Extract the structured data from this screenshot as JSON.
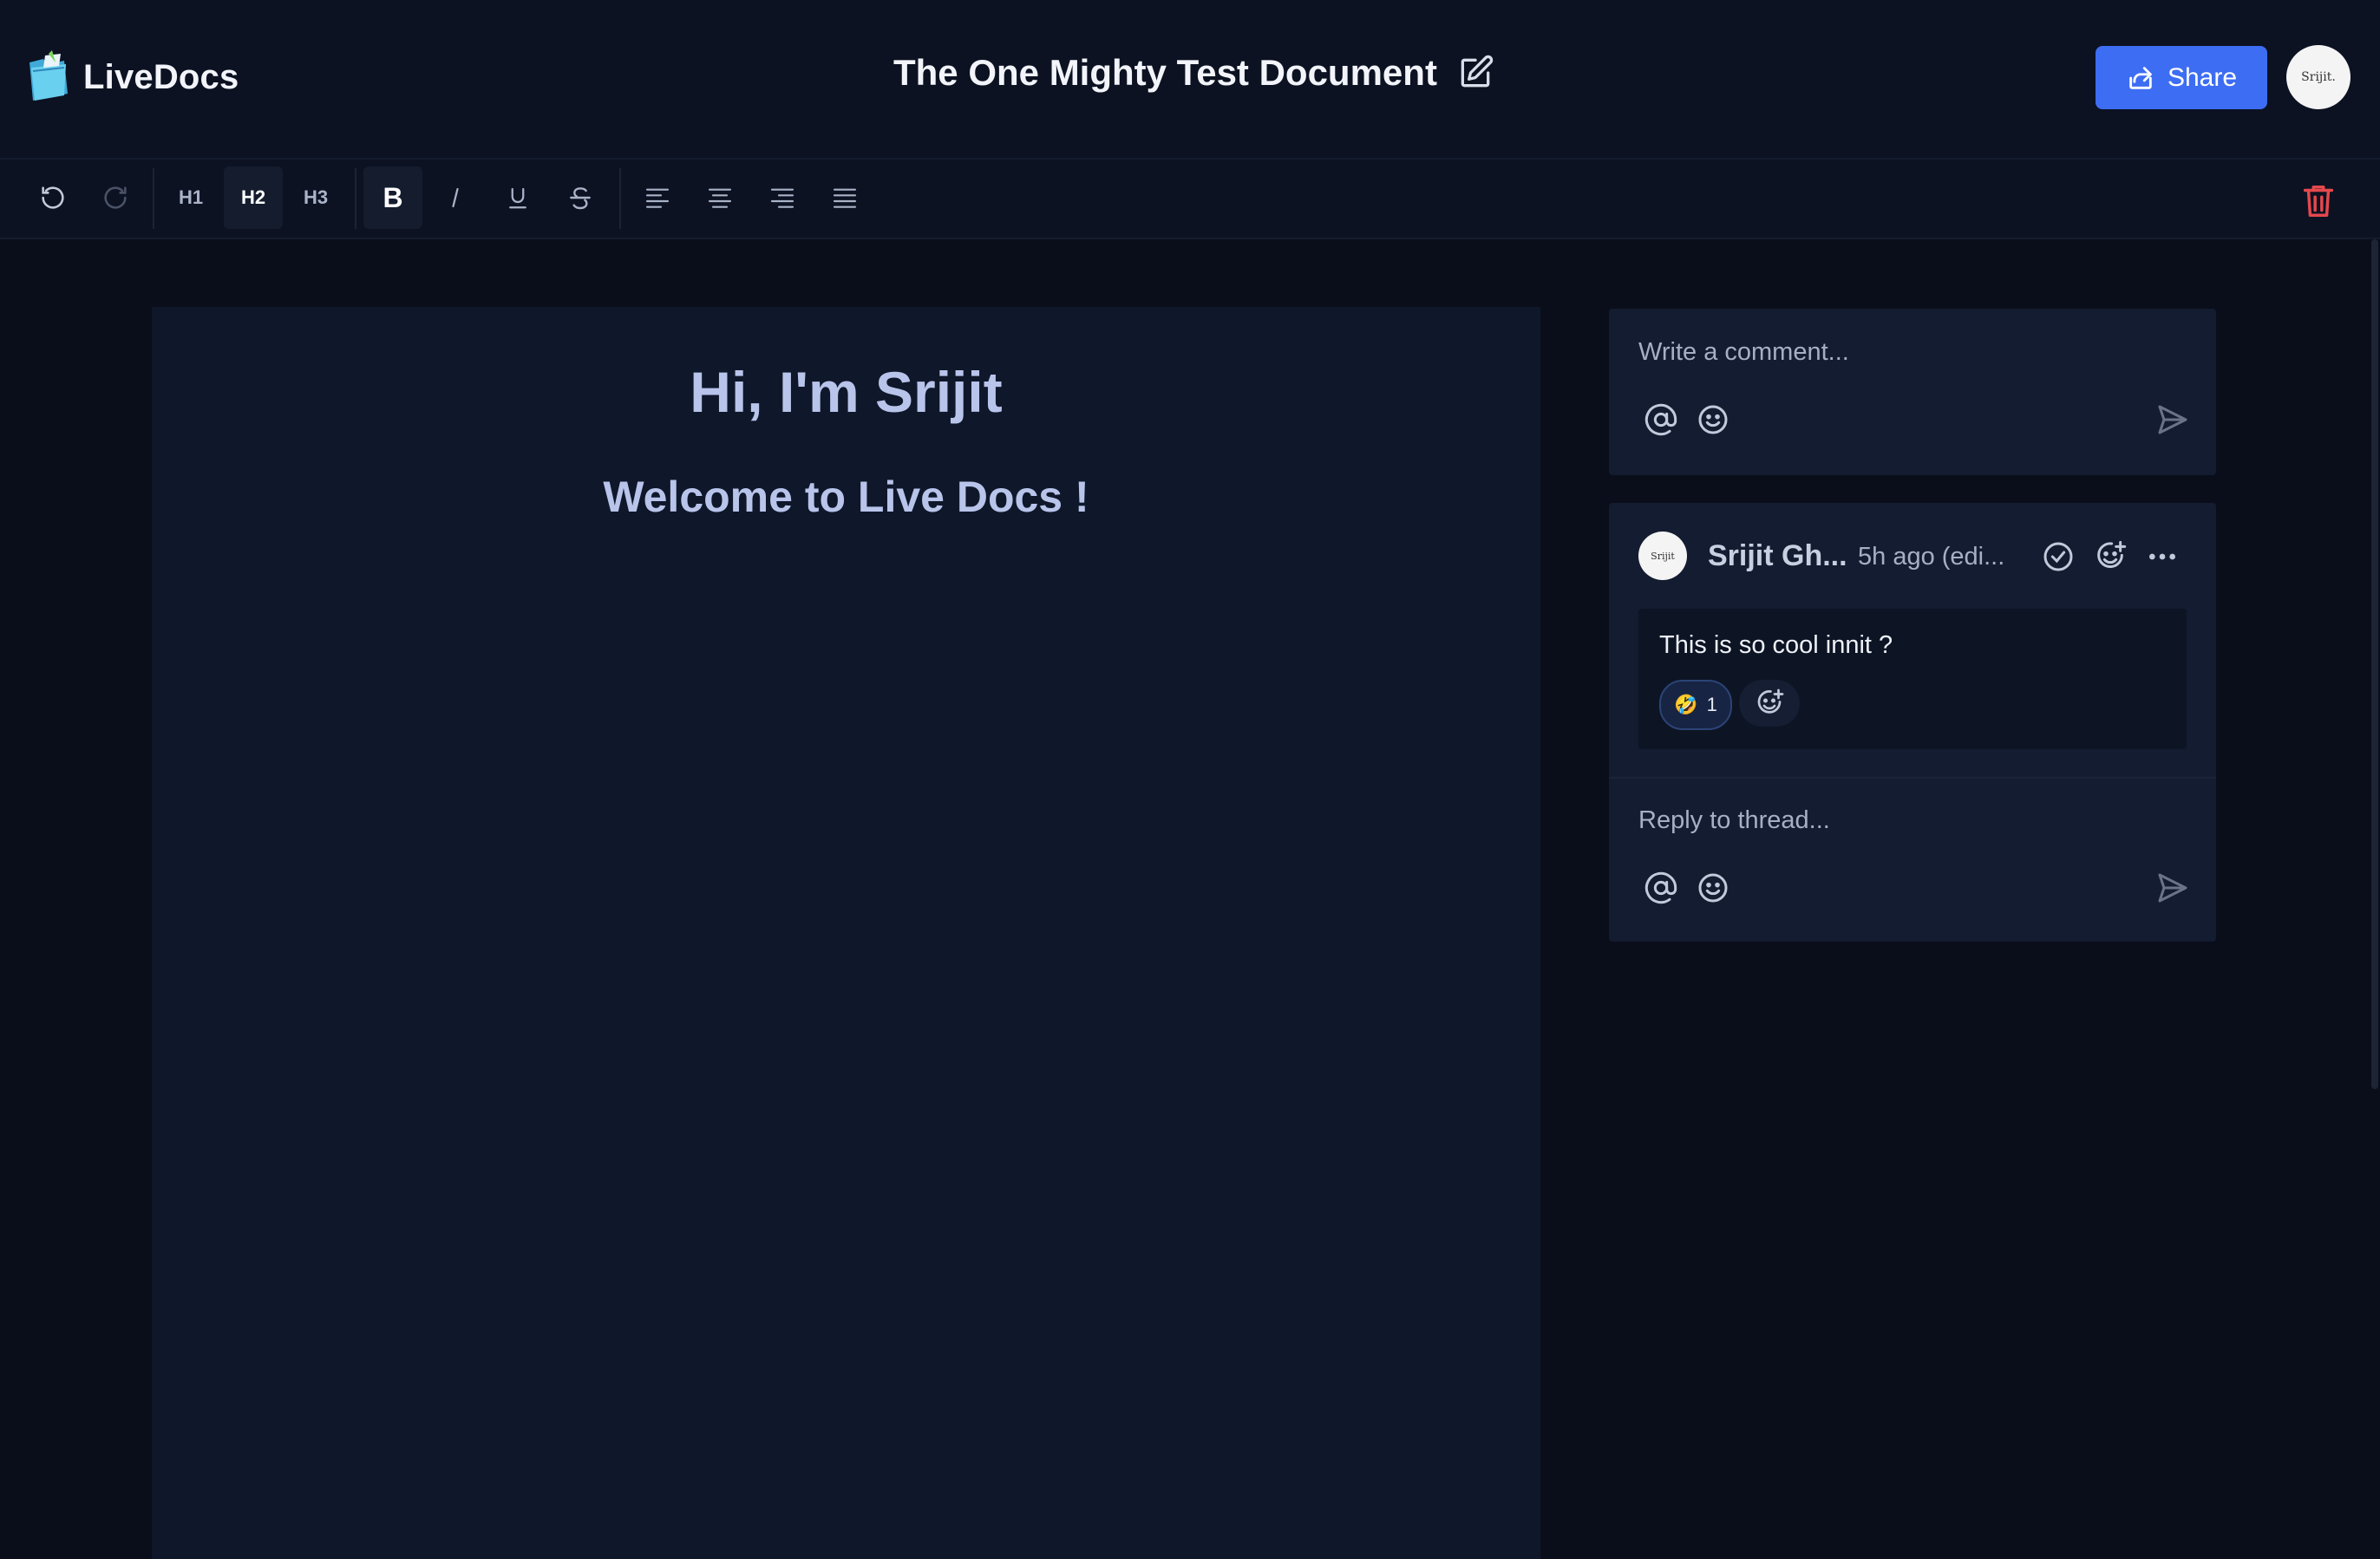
{
  "app": {
    "name": "LiveDocs",
    "document_title": "The One Mighty Test Document",
    "share_label": "Share",
    "user_avatar_text": "Srijit."
  },
  "toolbar": {
    "h1": "H1",
    "h2": "H2",
    "h3": "H3",
    "bold": "B",
    "active_heading": "H2",
    "icons": [
      "undo-icon",
      "redo-icon",
      "bold-icon",
      "italic-icon",
      "underline-icon",
      "strikethrough-icon",
      "align-left-icon",
      "align-center-icon",
      "align-right-icon",
      "align-justify-icon",
      "trash-icon"
    ]
  },
  "editor": {
    "heading1": "Hi, I'm Srijit",
    "heading2": "Welcome to Live Docs !"
  },
  "comments": {
    "composer_placeholder": "Write a comment...",
    "thread": {
      "author": "Srijit Gh...",
      "time": "5h ago (edi...",
      "avatar_text": "Srijit",
      "message": "This is so cool innit ?",
      "reaction_emoji": "🤣",
      "reaction_count": "1",
      "reply_placeholder": "Reply to thread..."
    }
  },
  "colors": {
    "background": "#0a0e1a",
    "header": "#0c1222",
    "editor": "#0f172a",
    "accent": "#3d6df2",
    "heading_text": "#b8c4ea",
    "danger": "#e5484d"
  }
}
